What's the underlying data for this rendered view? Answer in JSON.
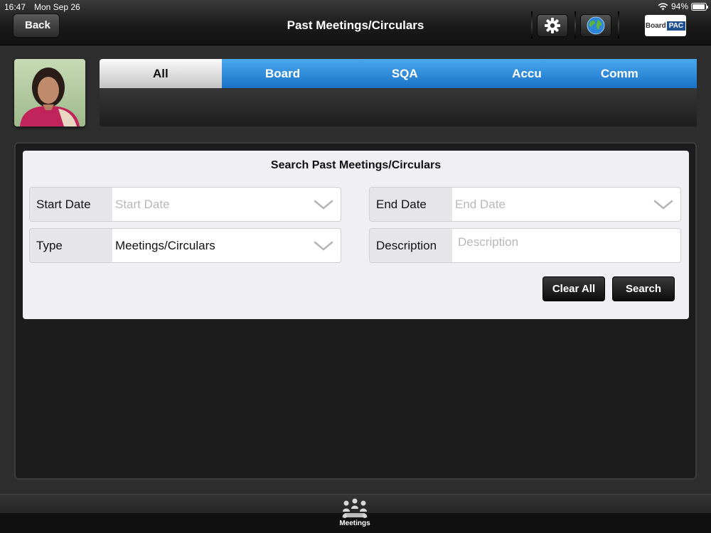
{
  "status": {
    "time": "16:47",
    "date": "Mon Sep 26",
    "battery": "94%"
  },
  "nav": {
    "back_label": "Back",
    "title": "Past Meetings/Circulars",
    "logo_text_left": "Board",
    "logo_text_right": "PAC"
  },
  "tabs": [
    {
      "label": "All",
      "active": true
    },
    {
      "label": "Board",
      "active": false
    },
    {
      "label": "SQA",
      "active": false
    },
    {
      "label": "Accu",
      "active": false
    },
    {
      "label": "Comm",
      "active": false
    }
  ],
  "search": {
    "title": "Search Past Meetings/Circulars",
    "start_date": {
      "label": "Start Date",
      "placeholder": "Start Date"
    },
    "end_date": {
      "label": "End Date",
      "placeholder": "End Date"
    },
    "type": {
      "label": "Type",
      "value": "Meetings/Circulars"
    },
    "description": {
      "label": "Description",
      "placeholder": "Description"
    },
    "clear_label": "Clear All",
    "search_label": "Search"
  },
  "bottom": {
    "meetings_label": "Meetings"
  },
  "colors": {
    "tab_blue": "#2b8ce0",
    "active_tab": "#e6e6e6",
    "card_bg": "#efeff4"
  },
  "icons": [
    "gear-icon",
    "globe-icon",
    "chevron-down-icon",
    "meetings-icon",
    "wifi-icon",
    "battery-icon"
  ]
}
